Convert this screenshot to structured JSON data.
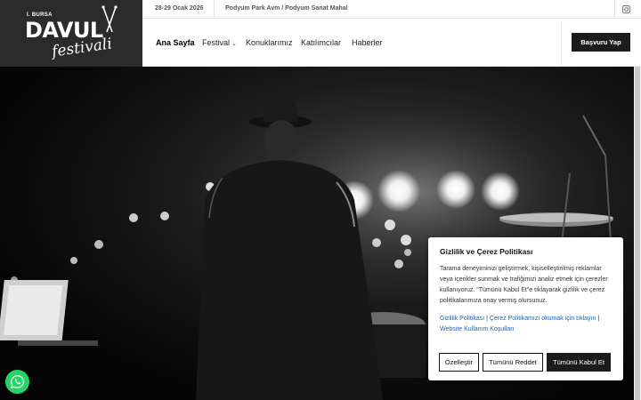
{
  "logo": {
    "edition": "I. BURSA",
    "brand": "DAVUL",
    "script": "festivali"
  },
  "topbar": {
    "date": "28-29 Ocak 2026",
    "venue": "Podyum Park Avm / Podyum Sanat Mahal"
  },
  "nav": {
    "items": [
      {
        "label": "Ana Sayfa"
      },
      {
        "label": "Festival"
      },
      {
        "label": "Konuklarımız"
      },
      {
        "label": "Katılımcılar"
      },
      {
        "label": "Haberler"
      }
    ],
    "apply_label": "Başvuru Yap"
  },
  "cookie": {
    "title": "Gizlilik ve Çerez Politikası",
    "text": "Tarama deneyiminizi geliştirmek, kişiselleştirilmiş reklamlar veya içerikler sunmak ve trafiğimizi analiz etmek için çerezler kullanıyoruz. \"Tümünü Kabul Et\"e tıklayarak gizlilik ve çerez politikalarımıza onay vermiş olursunuz.",
    "link1": "Gizlilik Politikası",
    "sep": "|",
    "link2": "Çerez Politikamızı okumak için tıklayın",
    "link3": "Website Kullanım Koşulları",
    "btn_customize": "Özelleştir",
    "btn_reject": "Tümünü Reddet",
    "btn_accept": "Tümünü Kabul Et"
  },
  "icons": {
    "social": "instagram-icon",
    "chat": "whatsapp-icon"
  },
  "colors": {
    "dark": "#1c1c1c",
    "link": "#1a5fb4",
    "whatsapp": "#25d366"
  }
}
